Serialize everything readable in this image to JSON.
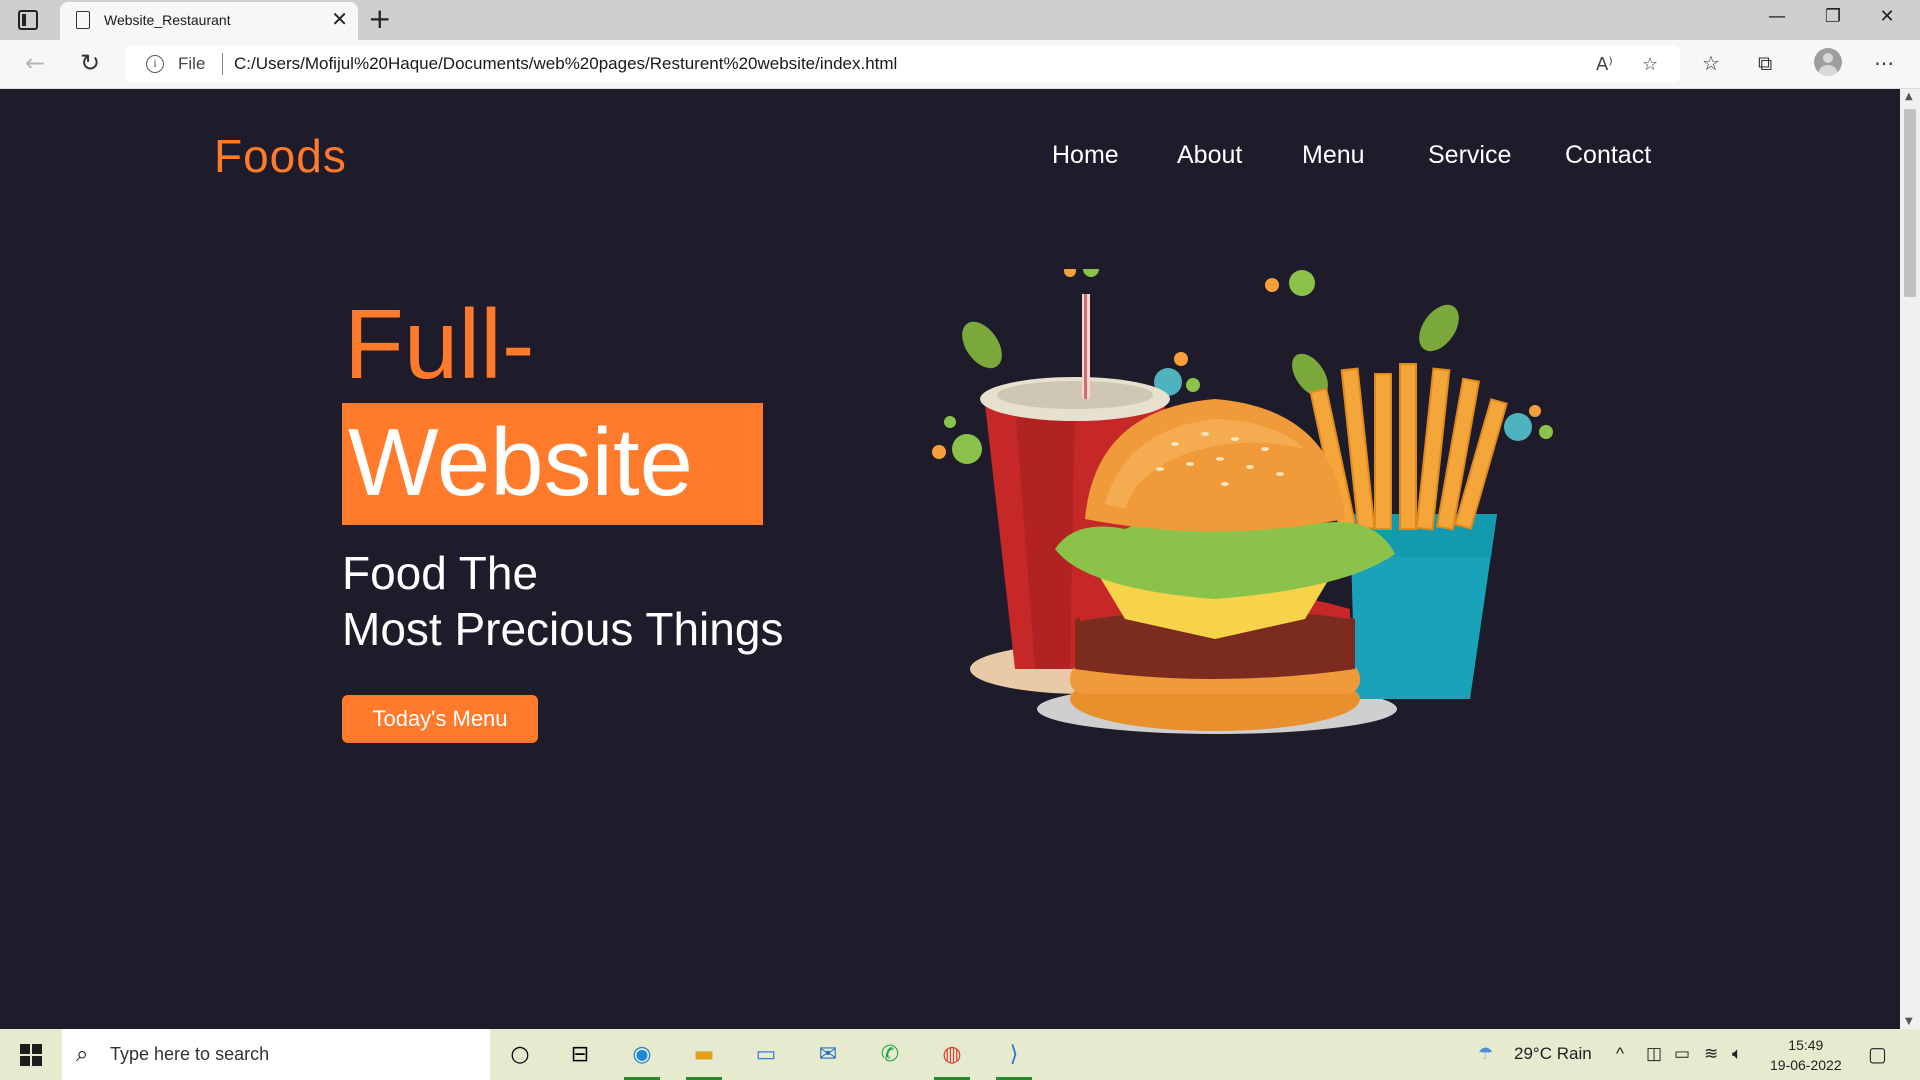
{
  "browser": {
    "tab": {
      "title": "Website_Restaurant"
    },
    "address": {
      "scheme_label": "File",
      "url": "C:/Users/Mofijul%20Haque/Documents/web%20pages/Resturent%20website/index.html"
    }
  },
  "site": {
    "logo": "Foods",
    "nav": [
      "Home",
      "About",
      "Menu",
      "Service",
      "Contact"
    ],
    "hero": {
      "line1": "Full-",
      "line2": "Website",
      "sub1": "Food The",
      "sub2": "Most Precious Things",
      "cta": "Today's Menu"
    },
    "accent_color": "#ff7a2a",
    "background_color": "#1e1b2b"
  },
  "taskbar": {
    "search_placeholder": "Type here to search",
    "weather": "29°C  Rain",
    "time": "15:49",
    "date": "19-06-2022",
    "apps": [
      "task-view-icon",
      "edge-icon",
      "file-explorer-icon",
      "this-pc-icon",
      "mail-icon",
      "whatsapp-icon",
      "chrome-icon",
      "vscode-icon"
    ]
  }
}
